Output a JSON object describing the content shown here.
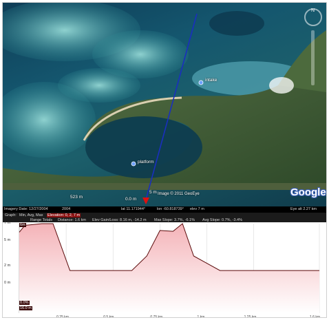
{
  "map": {
    "placemarks": [
      {
        "id": "intake",
        "label": "intake"
      },
      {
        "id": "platform",
        "label": "platform"
      }
    ],
    "copyright": "Image © 2011 GeoEye",
    "logo": "Google",
    "compass_north": "N",
    "scale_left": "523 m",
    "marker_distance": "5 m",
    "marker_elev": "0.0 m",
    "colors": {
      "path": "#1a2fbf",
      "water": "#14566e",
      "land": "#3f5f38"
    }
  },
  "statusbar": {
    "imagery_date": "Imagery Date: 12/27/2004",
    "year": "2004",
    "lat": "lat  11.171944°",
    "lon": "lon  -60.818739°",
    "elev": "elev    7 m",
    "eye_alt": "Eye alt    2.27 km"
  },
  "profile": {
    "header_row1": {
      "graph": "Graph:",
      "min_avg_max": "Min, Avg, Max",
      "elevation": "Elevation: 0, 2, 7 m"
    },
    "header_row2": {
      "range_totals": "Range Totals",
      "distance": "Distance: 1.6 km",
      "gain_loss": "Elev Gain/Loss: 8.16 m, -14.2 m",
      "max_slope": "Max Slope: 3.7%, -6.1%",
      "avg_slope": "Avg Slope: 0.7%, -3.4%"
    },
    "max_box": "6m",
    "min_box": "0.0%",
    "start_box": "16.0 m"
  },
  "chart_data": {
    "type": "area",
    "title": "",
    "xlabel": "",
    "ylabel": "",
    "x_ticks": [
      "0.25 km",
      "0.5 km",
      "0.75 km",
      "1 km",
      "1.25 km",
      "1.6 km"
    ],
    "y_ticks": [
      "7 m",
      "5 m",
      "2 m",
      "0 m"
    ],
    "ylim": [
      -3.5,
      7
    ],
    "xlim": [
      0,
      1.6
    ],
    "x": [
      0,
      0.03,
      0.12,
      0.18,
      0.27,
      0.5,
      0.6,
      0.68,
      0.75,
      0.82,
      0.87,
      0.93,
      1.07,
      1.13,
      1.6
    ],
    "y": [
      6,
      6.8,
      7,
      7,
      1.5,
      1.5,
      1.5,
      3.2,
      6.2,
      6.1,
      7,
      3.2,
      1.5,
      1.5,
      1.5
    ],
    "colors": {
      "line": "#5a0a0a",
      "fill_top": "#f4b3b8",
      "fill_bottom": "#ffffff"
    }
  }
}
